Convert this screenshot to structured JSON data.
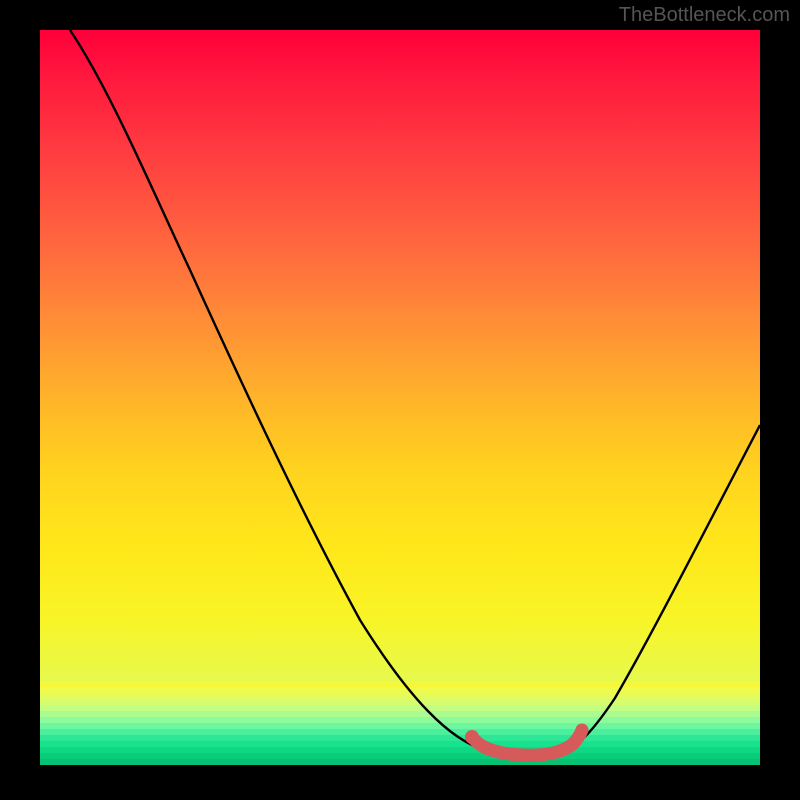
{
  "attribution": "TheBottleneck.com",
  "chart_data": {
    "type": "line",
    "title": "",
    "xlabel": "",
    "ylabel": "",
    "xlim": [
      0,
      100
    ],
    "ylim": [
      0,
      100
    ],
    "series": [
      {
        "name": "bottleneck_curve",
        "x": [
          5,
          10,
          15,
          20,
          25,
          30,
          35,
          40,
          45,
          50,
          55,
          60,
          62,
          67,
          72,
          75,
          80,
          85,
          90,
          95,
          100
        ],
        "y": [
          100,
          92,
          84,
          76,
          67,
          59,
          50,
          42,
          33,
          25,
          17,
          9,
          5,
          2,
          1.5,
          4,
          13,
          23,
          33,
          43,
          53
        ]
      }
    ],
    "optimal_range": {
      "x": [
        62,
        75
      ],
      "y": [
        4.5,
        1.5,
        4.5
      ]
    },
    "background_gradient_meaning": "red=high_bottleneck, green=low_bottleneck",
    "background_stops": [
      {
        "pos": 0.0,
        "color": "#ff003a"
      },
      {
        "pos": 0.18,
        "color": "#ff4140"
      },
      {
        "pos": 0.4,
        "color": "#ff8f36"
      },
      {
        "pos": 0.6,
        "color": "#ffd31e"
      },
      {
        "pos": 0.8,
        "color": "#f8f426"
      },
      {
        "pos": 0.92,
        "color": "#c9fb6c"
      },
      {
        "pos": 1.0,
        "color": "#17e38f"
      }
    ]
  }
}
